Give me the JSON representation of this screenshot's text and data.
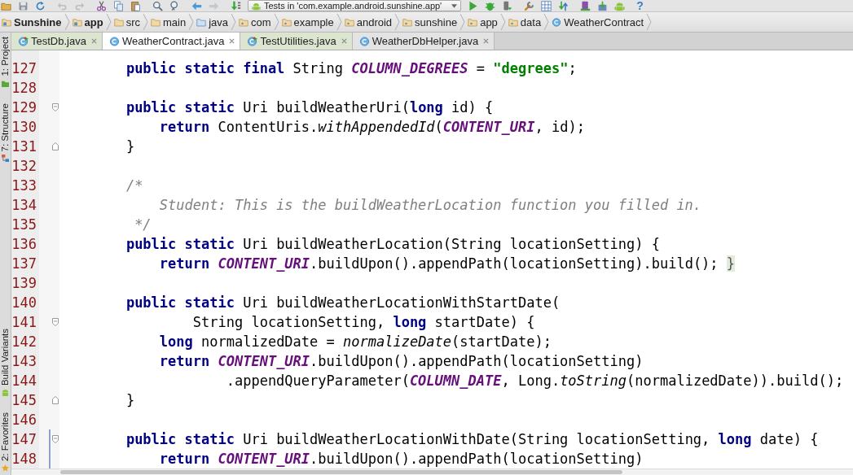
{
  "toolbar": {
    "groups": [
      {
        "items": [
          {
            "kind": "open",
            "disabled": false
          },
          {
            "kind": "save",
            "disabled": false
          },
          {
            "kind": "sync",
            "disabled": false
          }
        ]
      },
      {
        "items": [
          {
            "kind": "undo",
            "disabled": true
          },
          {
            "kind": "redo",
            "disabled": true
          }
        ]
      },
      {
        "items": [
          {
            "kind": "cut",
            "disabled": false
          },
          {
            "kind": "copy",
            "disabled": false
          },
          {
            "kind": "paste",
            "disabled": false
          }
        ]
      },
      {
        "items": [
          {
            "kind": "find",
            "disabled": false
          },
          {
            "kind": "replace",
            "disabled": false
          }
        ]
      },
      {
        "items": [
          {
            "kind": "back",
            "disabled": false
          },
          {
            "kind": "forward",
            "disabled": true
          }
        ]
      },
      {
        "items": [
          {
            "kind": "make",
            "disabled": false
          },
          {
            "kind": "run-config",
            "label": "Tests in 'com.example.android.sunshine.app'",
            "disabled": false
          },
          {
            "kind": "run",
            "disabled": false
          },
          {
            "kind": "debug",
            "disabled": false
          },
          {
            "kind": "attach",
            "disabled": false
          }
        ]
      },
      {
        "items": [
          {
            "kind": "tools",
            "disabled": false
          },
          {
            "kind": "structure",
            "disabled": false
          },
          {
            "kind": "sync-gradle",
            "disabled": false
          }
        ]
      },
      {
        "items": [
          {
            "kind": "avd",
            "disabled": false
          },
          {
            "kind": "sdk",
            "disabled": false
          },
          {
            "kind": "android",
            "disabled": false
          }
        ]
      },
      {
        "items": [
          {
            "kind": "help",
            "label": "?",
            "disabled": false
          }
        ]
      }
    ]
  },
  "breadcrumb": {
    "items": [
      {
        "label": "Sunshine",
        "kind": "project",
        "emphasized": true
      },
      {
        "label": "app",
        "kind": "module",
        "emphasized": true
      },
      {
        "label": "src",
        "kind": "folder",
        "emphasized": false
      },
      {
        "label": "main",
        "kind": "folder",
        "emphasized": false
      },
      {
        "label": "java",
        "kind": "source-folder",
        "emphasized": false
      },
      {
        "label": "com",
        "kind": "package",
        "emphasized": false
      },
      {
        "label": "example",
        "kind": "package",
        "emphasized": false
      },
      {
        "label": "android",
        "kind": "package",
        "emphasized": false
      },
      {
        "label": "sunshine",
        "kind": "package",
        "emphasized": false
      },
      {
        "label": "app",
        "kind": "package",
        "emphasized": false
      },
      {
        "label": "data",
        "kind": "package",
        "emphasized": false
      },
      {
        "label": "WeatherContract",
        "kind": "class",
        "emphasized": false
      }
    ]
  },
  "left_strip": {
    "top": [
      {
        "label": "1: Project",
        "kind": "project"
      },
      {
        "label": "7: Structure",
        "kind": "structure"
      }
    ],
    "bottom": [
      {
        "label": "Build Variants",
        "kind": "build-variants"
      },
      {
        "label": "2: Favorites",
        "kind": "favorites"
      }
    ]
  },
  "tabs": [
    {
      "label": "TestDb.java",
      "kind": "test",
      "selected": false
    },
    {
      "label": "WeatherContract.java",
      "kind": "class",
      "selected": true
    },
    {
      "label": "TestUtilities.java",
      "kind": "test",
      "selected": false
    },
    {
      "label": "WeatherDbHelper.java",
      "kind": "class",
      "selected": false
    }
  ],
  "editor": {
    "lines": [
      {
        "number": "127",
        "changed": false,
        "tokens": [
          {
            "kind": "keyword",
            "text": "        public static final"
          },
          {
            "kind": "plain",
            "text": " String "
          },
          {
            "kind": "constant",
            "text": "COLUMN_DEGREES"
          },
          {
            "kind": "plain",
            "text": " = "
          },
          {
            "kind": "string",
            "text": "\"degrees\""
          },
          {
            "kind": "plain",
            "text": ";"
          }
        ]
      },
      {
        "number": "128",
        "changed": false
      },
      {
        "number": "129",
        "changed": false,
        "fold_marker": {
          "kind": "start"
        },
        "tokens": [
          {
            "kind": "keyword",
            "text": "        public static"
          },
          {
            "kind": "plain",
            "text": " Uri buildWeatherUri("
          },
          {
            "kind": "keyword",
            "text": "long"
          },
          {
            "kind": "plain",
            "text": " id) {"
          }
        ]
      },
      {
        "number": "130",
        "changed": false,
        "tokens": [
          {
            "kind": "keyword",
            "text": "            return"
          },
          {
            "kind": "plain",
            "text": " ContentUris."
          },
          {
            "kind": "static",
            "text": "withAppendedId"
          },
          {
            "kind": "plain",
            "text": "("
          },
          {
            "kind": "constant",
            "text": "CONTENT_URI"
          },
          {
            "kind": "plain",
            "text": ", id);"
          }
        ]
      },
      {
        "number": "131",
        "changed": false,
        "fold_marker": {
          "kind": "end"
        },
        "tokens": [
          {
            "kind": "plain",
            "text": "        }"
          }
        ]
      },
      {
        "number": "132",
        "changed": false
      },
      {
        "number": "133",
        "changed": false,
        "tokens": [
          {
            "kind": "comment",
            "text": "        /*"
          }
        ]
      },
      {
        "number": "134",
        "changed": false,
        "tokens": [
          {
            "kind": "comment",
            "text": "            Student: This is the buildWeatherLocation function you filled in."
          }
        ]
      },
      {
        "number": "135",
        "changed": false,
        "tokens": [
          {
            "kind": "comment",
            "text": "         */"
          }
        ]
      },
      {
        "number": "136",
        "changed": false,
        "tokens": [
          {
            "kind": "keyword",
            "text": "        public static"
          },
          {
            "kind": "plain",
            "text": " Uri buildWeatherLocation(String locationSetting) {"
          }
        ]
      },
      {
        "number": "137",
        "changed": false,
        "tokens": [
          {
            "kind": "keyword",
            "text": "            return "
          },
          {
            "kind": "constant",
            "text": "CONTENT_URI"
          },
          {
            "kind": "plain",
            "text": ".buildUpon().appendPath(locationSetting).build(); "
          },
          {
            "kind": "fold",
            "text": "}"
          }
        ]
      },
      {
        "number": "139",
        "changed": false
      },
      {
        "number": "140",
        "changed": false,
        "tokens": [
          {
            "kind": "keyword",
            "text": "        public static"
          },
          {
            "kind": "plain",
            "text": " Uri buildWeatherLocationWithStartDate("
          }
        ]
      },
      {
        "number": "141",
        "changed": false,
        "fold_marker": {
          "kind": "start"
        },
        "tokens": [
          {
            "kind": "plain",
            "text": "                String locationSetting, "
          },
          {
            "kind": "keyword",
            "text": "long"
          },
          {
            "kind": "plain",
            "text": " startDate) {"
          }
        ]
      },
      {
        "number": "142",
        "changed": false,
        "tokens": [
          {
            "kind": "keyword",
            "text": "            long"
          },
          {
            "kind": "plain",
            "text": " normalizedDate = "
          },
          {
            "kind": "static",
            "text": "normalizeDate"
          },
          {
            "kind": "plain",
            "text": "(startDate);"
          }
        ]
      },
      {
        "number": "143",
        "changed": false,
        "tokens": [
          {
            "kind": "keyword",
            "text": "            return "
          },
          {
            "kind": "constant",
            "text": "CONTENT_URI"
          },
          {
            "kind": "plain",
            "text": ".buildUpon().appendPath(locationSetting)"
          }
        ]
      },
      {
        "number": "144",
        "changed": false,
        "tokens": [
          {
            "kind": "plain",
            "text": "                    .appendQueryParameter("
          },
          {
            "kind": "constant",
            "text": "COLUMN_DATE"
          },
          {
            "kind": "plain",
            "text": ", Long."
          },
          {
            "kind": "static",
            "text": "toString"
          },
          {
            "kind": "plain",
            "text": "(normalizedDate)).build();"
          }
        ]
      },
      {
        "number": "145",
        "changed": false,
        "fold_marker": {
          "kind": "end"
        },
        "tokens": [
          {
            "kind": "plain",
            "text": "        }"
          }
        ]
      },
      {
        "number": "146",
        "changed": false
      },
      {
        "number": "147",
        "changed": true,
        "fold_marker": {
          "kind": "start"
        },
        "tokens": [
          {
            "kind": "keyword",
            "text": "        public static"
          },
          {
            "kind": "plain",
            "text": " Uri buildWeatherLocationWithDate(String locationSetting, "
          },
          {
            "kind": "keyword",
            "text": "long"
          },
          {
            "kind": "plain",
            "text": " date) {"
          }
        ]
      },
      {
        "number": "148",
        "changed": true,
        "tokens": [
          {
            "kind": "keyword",
            "text": "            return "
          },
          {
            "kind": "constant",
            "text": "CONTENT_URI"
          },
          {
            "kind": "plain",
            "text": ".buildUpon().appendPath(locationSetting)"
          }
        ]
      }
    ]
  }
}
